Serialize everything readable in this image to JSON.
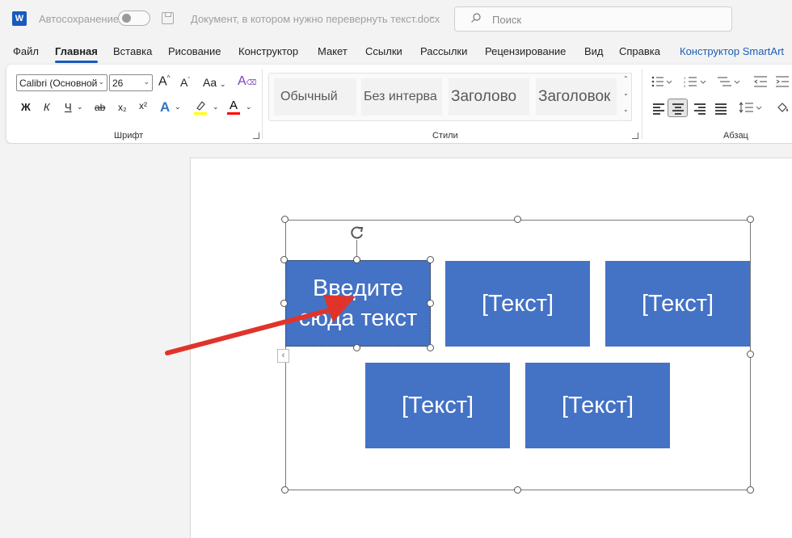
{
  "titlebar": {
    "autosave_label": "Автосохранение",
    "document_title": "Документ, в котором нужно перевернуть текст.docx",
    "search_placeholder": "Поиск"
  },
  "menu": [
    "Файл",
    "Главная",
    "Вставка",
    "Рисование",
    "Конструктор",
    "Макет",
    "Ссылки",
    "Рассылки",
    "Рецензирование",
    "Вид",
    "Справка",
    "Конструктор SmartArt"
  ],
  "ribbon": {
    "font": {
      "font_name": "Calibri (Основной",
      "font_size": "26",
      "grow_label": "A",
      "shrink_label": "A",
      "case_label": "Aa",
      "bold": "Ж",
      "italic": "К",
      "underline": "Ч",
      "strike": "ab",
      "subscript": "x₂",
      "superscript": "x²",
      "effects": "A",
      "color_letter": "A",
      "group_label": "Шрифт"
    },
    "styles": {
      "items": [
        "Обычный",
        "Без интерва",
        "Заголово",
        "Заголовок"
      ],
      "group_label": "Стили"
    },
    "paragraph": {
      "group_label": "Абзац"
    },
    "colors": {
      "highlight": "#ffff00",
      "font_color": "#ff0000",
      "accent": "#185abd"
    }
  },
  "smartart": {
    "selected_text": "Введите сюда текст",
    "placeholders": [
      "[Текст]",
      "[Текст]",
      "[Текст]",
      "[Текст]"
    ],
    "shape_color": "#4472c4",
    "arrow_color": "#e0342b"
  }
}
